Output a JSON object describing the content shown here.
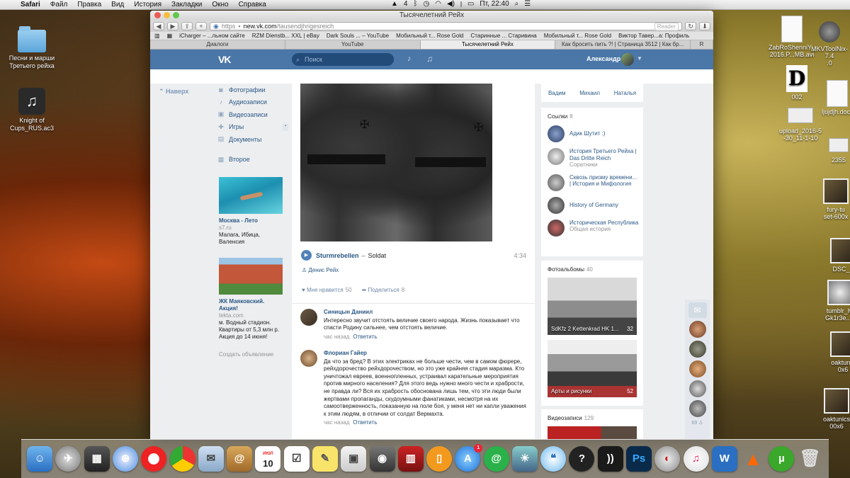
{
  "menubar": {
    "app": "Safari",
    "items": [
      "Файл",
      "Правка",
      "Вид",
      "История",
      "Закладки",
      "Окно",
      "Справка"
    ],
    "num": "4",
    "clock": "Пт, 22:40"
  },
  "desktop_left": [
    {
      "label": "Песни и марши\nТретьего рейха"
    },
    {
      "label": "Knight of\nCups_RUS.ac3"
    }
  ],
  "desktop_right": {
    "i1": "ZabRoShenniY_\n2016.P...MB.avi",
    "i2": "MKVToolNix-7.4\n.0",
    "i3": "002",
    "i4": "ljujdjh.docx",
    "i5": "upload_2016-5\n-30_11-1-10",
    "i6": "2355",
    "i7": "fury-tu\nset-600x",
    "i8": "DSC_1",
    "i9": "tumblr_lvl\nGk1r3e...1",
    "i10": "oaktunic\n0x6",
    "i11": "oaktunics\n00x6"
  },
  "window": {
    "title": "Тысячелетний Рейх",
    "url_proto": "https",
    "url_host": "new.vk.com",
    "url_path": "/tausendjhrigesreich",
    "reader": "Reader",
    "bookmarks": [
      "iCharger – ...льном сайте",
      "RZM Dienstb... XXL | eBay",
      "Dark Souls ... – YouTube",
      "Мобильный т... Rose Gold",
      "Старинные ... Старивина",
      "Мобильный т... Rose Gold",
      "Виктор Тавер...а: Профиль"
    ],
    "tabs": [
      "Диалоги",
      "YouTube",
      "Тысячелетний Рейх",
      "Как бросить пить ?! | Страница 3512 | Как бр...",
      "R"
    ]
  },
  "vk": {
    "search_placeholder": "Поиск",
    "user": "Александр",
    "back_to_top": "Наверх",
    "nav": [
      "Фотографии",
      "Аудиозаписи",
      "Видеозаписи",
      "Игры",
      "Документы",
      "Второе"
    ],
    "ads": [
      {
        "title": "Москва - Лето",
        "domain": "s7.ru",
        "text": "Малага, Ибица,\nВаленсия"
      },
      {
        "title": "ЖК Маяковский.\nАкция!",
        "domain": "tekta.com",
        "text": "м. Водный стадион.\nКвартиры от 5,3 млн р.\nАкция до 14 июня!"
      }
    ],
    "create_ad": "Создать объявление",
    "post": {
      "track_artist": "Sturmrebellen",
      "track_sep": "–",
      "track_title": "Soldat",
      "track_duration": "4:34",
      "author": "Денис Рейх",
      "likes_label": "Мне нравится",
      "likes": "50",
      "shares_label": "Поделиться",
      "shares": "8"
    },
    "comments": [
      {
        "name": "Синицын Даниил",
        "text": "Интересно звучит отстоять величие своего народа. Жизнь показывает что спасти Родину сильнее, чем отстоять величие.",
        "time": "час назад",
        "reply": "Ответить"
      },
      {
        "name": "Флориан Гайер",
        "text": "Да что за бред? В этих электриках не больше чести, чем в самом фюрере, рейхдорочество рейхдорочеством, но это уже крайняя стадия маразма. Кто уничтожал евреев, военнопленных, устраивал карательные мероприятия против мирного населения? Для этого ведь нужно много чести и храбрости, не правда ли? Вся их храбрость обоснована лишь тем, что эти люди были жертвами пропаганды, скудоумными фанатиками, несмотря на их самоотверженность, показанную на поле боя, у меня нет ни капли уважения к этим людям, в отличии от солдат Вермахта.",
        "time": "час назад",
        "reply": "Ответить"
      }
    ],
    "friends": [
      "Вадим",
      "Михаил",
      "Наталья"
    ],
    "links_title": "Ссылки",
    "links_count": "8",
    "links": [
      {
        "title": "Адик Шутит :)",
        "sub": ""
      },
      {
        "title": "История Третьего Рейха | Das Dritte Reich",
        "sub": "Соратники"
      },
      {
        "title": "Сквозь призму времени... | История и Мифология",
        "sub": ""
      },
      {
        "title": "History of Germany",
        "sub": ""
      },
      {
        "title": "Историческая Республика",
        "sub": "Общая история"
      }
    ],
    "albums_title": "Фотоальбомы",
    "albums_count": "40",
    "albums": [
      {
        "caption": "SdKfz 2 Kettenkrad HK 1...",
        "count": "32"
      },
      {
        "caption": "Арты и рисунки",
        "count": "52"
      }
    ],
    "videos_title": "Видеозаписи",
    "videos_count": "129",
    "online_count": "69"
  },
  "dock": {
    "calendar_month": "ИЮЛ",
    "calendar_day": "10",
    "appstore_badge": "1",
    "ps_label": "Ps"
  }
}
